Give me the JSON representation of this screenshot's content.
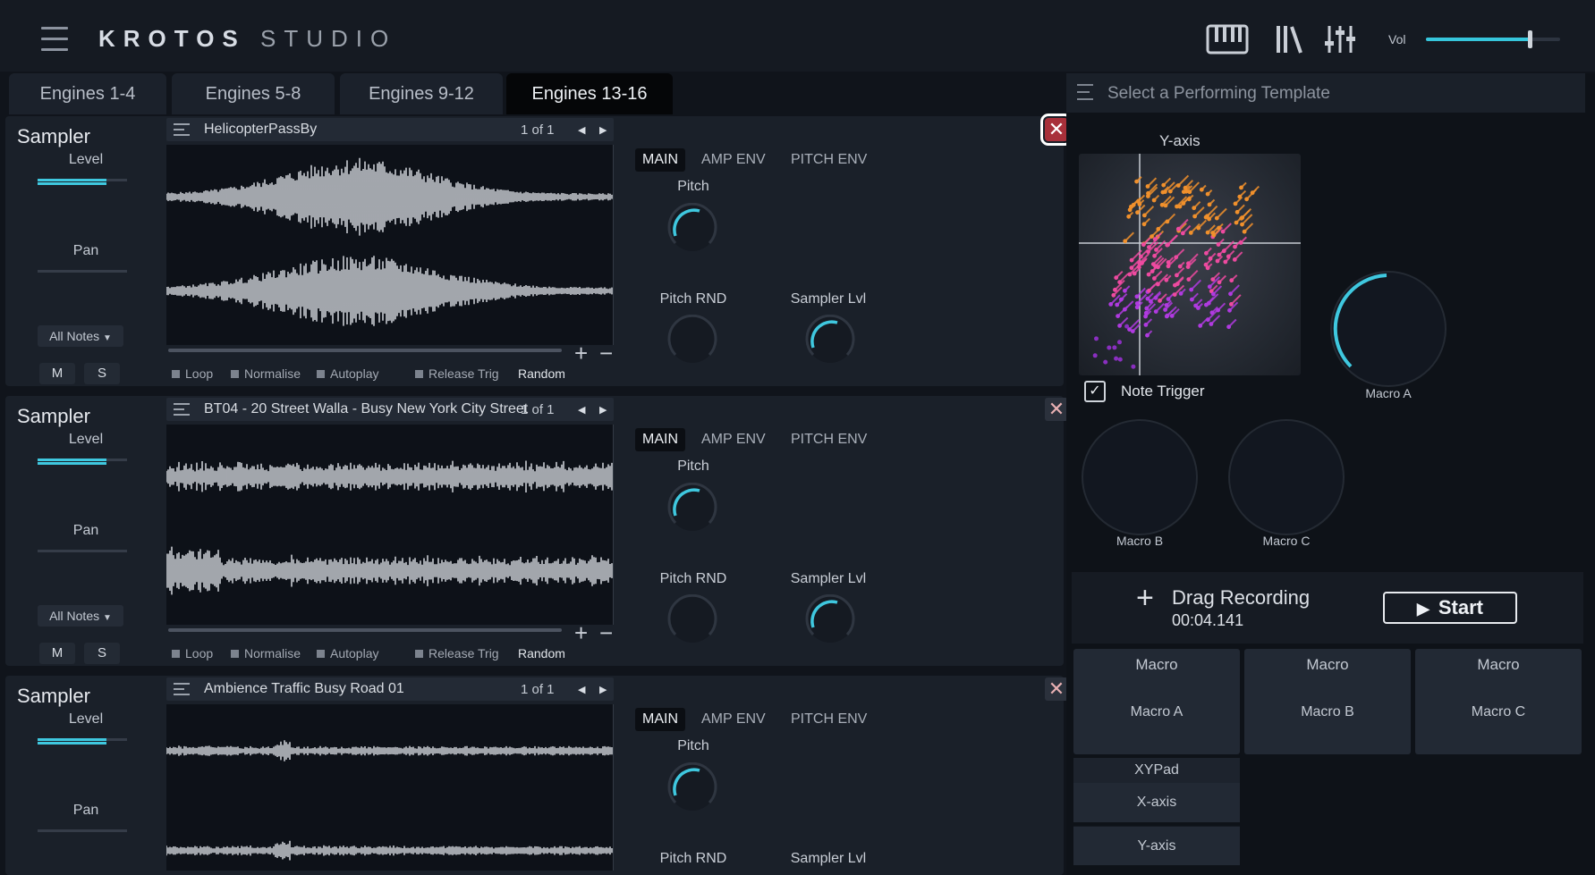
{
  "app": {
    "logo_bold": "KROTOS",
    "logo_light": "STUDIO"
  },
  "header": {
    "vol_label": "Vol",
    "vol_value": 0.77,
    "icons": [
      "keyboard-icon",
      "library-icon",
      "mixer-icon"
    ]
  },
  "tabs": [
    {
      "label": "Engines 1-4",
      "active": false
    },
    {
      "label": "Engines 5-8",
      "active": false
    },
    {
      "label": "Engines 9-12",
      "active": false
    },
    {
      "label": "Engines 13-16",
      "active": true
    }
  ],
  "engines": [
    {
      "title": "Sampler",
      "level_label": "Level",
      "level": 0.77,
      "pan_label": "Pan",
      "notes": "All Notes",
      "mute": "M",
      "solo": "S",
      "sample": "HelicopterPassBy",
      "count": "1 of 1",
      "options": [
        "Loop",
        "Normalise",
        "Autoplay",
        "Release Trig"
      ],
      "random": "Random",
      "subtabs": [
        "MAIN",
        "AMP ENV",
        "PITCH ENV"
      ],
      "knobs": {
        "pitch": "Pitch",
        "pitch_rnd": "Pitch RND",
        "sampler_lvl": "Sampler Lvl"
      }
    },
    {
      "title": "Sampler",
      "level_label": "Level",
      "level": 0.77,
      "pan_label": "Pan",
      "notes": "All Notes",
      "mute": "M",
      "solo": "S",
      "sample": "BT04 - 20 Street Walla - Busy New York City Street",
      "count": "1 of 1",
      "options": [
        "Loop",
        "Normalise",
        "Autoplay",
        "Release Trig"
      ],
      "random": "Random",
      "subtabs": [
        "MAIN",
        "AMP ENV",
        "PITCH ENV"
      ],
      "knobs": {
        "pitch": "Pitch",
        "pitch_rnd": "Pitch RND",
        "sampler_lvl": "Sampler Lvl"
      }
    },
    {
      "title": "Sampler",
      "level_label": "Level",
      "level": 0.77,
      "pan_label": "Pan",
      "sample": "Ambience Traffic Busy Road 01",
      "count": "1 of 1",
      "subtabs": [
        "MAIN",
        "AMP ENV",
        "PITCH ENV"
      ],
      "knobs": {
        "pitch": "Pitch",
        "pitch_rnd": "Pitch RND",
        "sampler_lvl": "Sampler Lvl"
      }
    }
  ],
  "close_glyph": "✕",
  "right": {
    "template_placeholder": "Select a Performing Template",
    "y_axis_label": "Y-axis",
    "note_trigger": "Note Trigger",
    "note_trigger_checked": true,
    "macro_a": "Macro A",
    "macro_b": "Macro B",
    "macro_c": "Macro C",
    "drag_recording": "Drag Recording",
    "rec_time": "00:04.141",
    "start": "Start",
    "macro_cells": [
      {
        "head": "Macro",
        "body": "Macro A"
      },
      {
        "head": "Macro",
        "body": "Macro B"
      },
      {
        "head": "Macro",
        "body": "Macro C"
      }
    ],
    "xypad": {
      "head": "XYPad",
      "x": "X-axis",
      "y": "Y-axis"
    }
  },
  "colors": {
    "accent": "#3fc8df",
    "close_active": "#a8303a"
  }
}
